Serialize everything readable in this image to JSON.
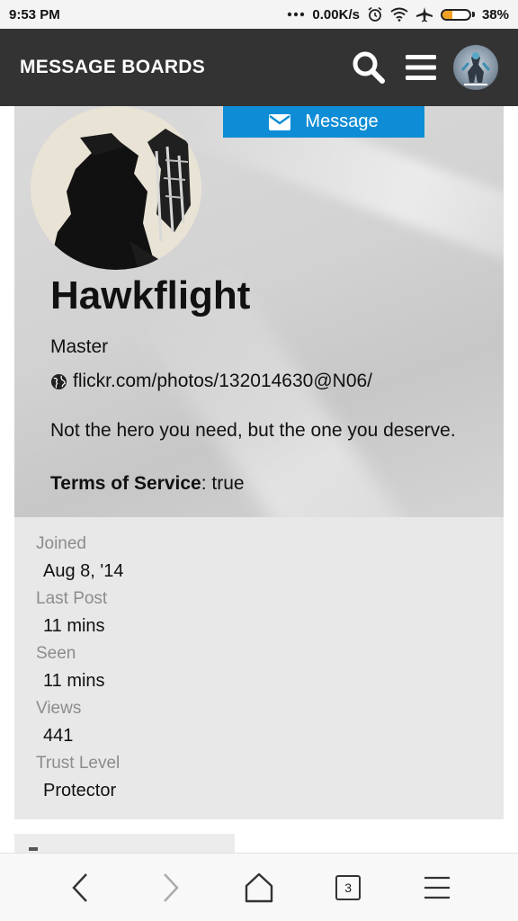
{
  "status_bar": {
    "time": "9:53 PM",
    "network_speed": "0.00K/s",
    "battery_percent_label": "38%",
    "battery_level": 0.38,
    "icons": [
      "more-dots-icon",
      "alarm-icon",
      "wifi-icon",
      "airplane-mode-icon",
      "battery-icon"
    ]
  },
  "header": {
    "title": "MESSAGE BOARDS",
    "icons": [
      "search-icon",
      "menu-icon",
      "user-avatar"
    ]
  },
  "profile": {
    "message_button_label": "Message",
    "username": "Hawkflight",
    "title": "Master",
    "website": "flickr.com/photos/132014630@N06/",
    "bio": "Not the hero you need, but the one you deserve.",
    "tos_label": "Terms of Service",
    "tos_value": ": true"
  },
  "stats": [
    {
      "label": "Joined",
      "value": "Aug 8, '14"
    },
    {
      "label": "Last Post",
      "value": "11 mins"
    },
    {
      "label": "Seen",
      "value": "11 mins"
    },
    {
      "label": "Views",
      "value": "441"
    },
    {
      "label": "Trust Level",
      "value": "Protector"
    }
  ],
  "bottom_nav": {
    "tabs_count": "3",
    "icons": [
      "back-icon",
      "forward-icon",
      "home-icon",
      "tabs-icon",
      "menu-icon"
    ]
  },
  "colors": {
    "header_bg": "#333333",
    "message_button": "#0e8dd6",
    "battery_fill": "#f1a224"
  }
}
